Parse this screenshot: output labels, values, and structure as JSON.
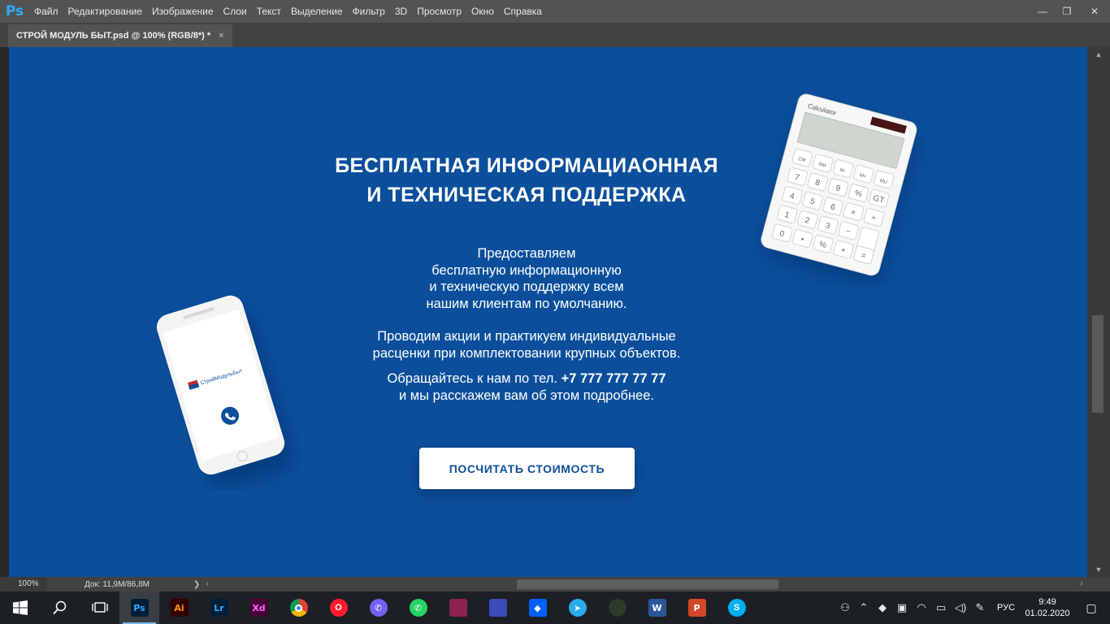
{
  "app": {
    "logo": "Ps",
    "menu": [
      "Файл",
      "Редактирование",
      "Изображение",
      "Слои",
      "Текст",
      "Выделение",
      "Фильтр",
      "3D",
      "Просмотр",
      "Окно",
      "Справка"
    ],
    "window_controls": {
      "minimize": "—",
      "restore": "❐",
      "close": "✕"
    }
  },
  "document_tab": {
    "title": "СТРОЙ МОДУЛЬ БЫТ.psd @ 100% (RGB/8*) *",
    "close": "×"
  },
  "canvas": {
    "background_color": "#0b4f9c",
    "headline": [
      "БЕСПЛАТНАЯ ИНФОРМАЦИАОННАЯ",
      "И ТЕХНИЧЕСКАЯ ПОДДЕРЖКА"
    ],
    "paragraph1": [
      "Предоставляем",
      "бесплатную информационную",
      "и техническую поддержку всем",
      "нашим клиентам по умолчанию."
    ],
    "paragraph2": [
      "Проводим акции и практикуем индивидуальные",
      "расценки при комплектовании крупных объектов."
    ],
    "contact_prefix": "Обращайтесь к нам по тел. ",
    "contact_phone": "+7 777 777 77 77",
    "contact_suffix": "и мы расскажем вам об этом подробнее.",
    "cta_label": "ПОСЧИТАТЬ СТОИМОСТЬ",
    "phone_logo_text": "СтройМодульБыт",
    "calculator": {
      "brand": "Calculator",
      "keys": [
        [
          "CM",
          "RM",
          "M-",
          "M+",
          "MU"
        ],
        [
          "7",
          "8",
          "9",
          "%",
          "GT"
        ],
        [
          "4",
          "5",
          "6",
          "×",
          "÷"
        ],
        [
          "1",
          "2",
          "3",
          "−",
          ""
        ],
        [
          "0",
          "•",
          "%",
          "+",
          "="
        ]
      ]
    }
  },
  "status": {
    "zoom": "100%",
    "doc_size": "Док: 11,9M/86,8M",
    "arrow": "❯"
  },
  "taskbar": {
    "apps": [
      {
        "name": "photoshop",
        "label": "Ps",
        "bg": "#001e36",
        "fg": "#31a8ff",
        "shape": "square",
        "active": true
      },
      {
        "name": "illustrator",
        "label": "Ai",
        "bg": "#330000",
        "fg": "#ff9a00",
        "shape": "square"
      },
      {
        "name": "lightroom",
        "label": "Lr",
        "bg": "#001e36",
        "fg": "#31a8ff",
        "shape": "square"
      },
      {
        "name": "xd",
        "label": "Xd",
        "bg": "#470137",
        "fg": "#ff61f6",
        "shape": "square"
      },
      {
        "name": "chrome",
        "label": "",
        "bg": "#e4372b",
        "fg": "#fff",
        "shape": "circle"
      },
      {
        "name": "opera",
        "label": "O",
        "bg": "#ff1b2d",
        "fg": "#fff",
        "shape": "circle"
      },
      {
        "name": "viber",
        "label": "✆",
        "bg": "#7360f2",
        "fg": "#fff",
        "shape": "circle"
      },
      {
        "name": "whatsapp",
        "label": "✆",
        "bg": "#25d366",
        "fg": "#fff",
        "shape": "circle"
      },
      {
        "name": "winrar",
        "label": "",
        "bg": "#8b2252",
        "fg": "#fff",
        "shape": "square"
      },
      {
        "name": "save",
        "label": "",
        "bg": "#3b4bb8",
        "fg": "#fff",
        "shape": "square"
      },
      {
        "name": "dropbox",
        "label": "◆",
        "bg": "#0061fe",
        "fg": "#fff",
        "shape": "square"
      },
      {
        "name": "telegram",
        "label": "➤",
        "bg": "#2aabee",
        "fg": "#fff",
        "shape": "circle"
      },
      {
        "name": "android",
        "label": "",
        "bg": "#2b3a2b",
        "fg": "#a4c639",
        "shape": "circle"
      },
      {
        "name": "word",
        "label": "W",
        "bg": "#2b579a",
        "fg": "#fff",
        "shape": "square"
      },
      {
        "name": "powerpoint",
        "label": "P",
        "bg": "#d24726",
        "fg": "#fff",
        "shape": "square"
      },
      {
        "name": "skype",
        "label": "S",
        "bg": "#00aff0",
        "fg": "#fff",
        "shape": "circle"
      }
    ],
    "tray": {
      "lang": "РУС",
      "time": "9:49",
      "date": "01.02.2020"
    }
  }
}
